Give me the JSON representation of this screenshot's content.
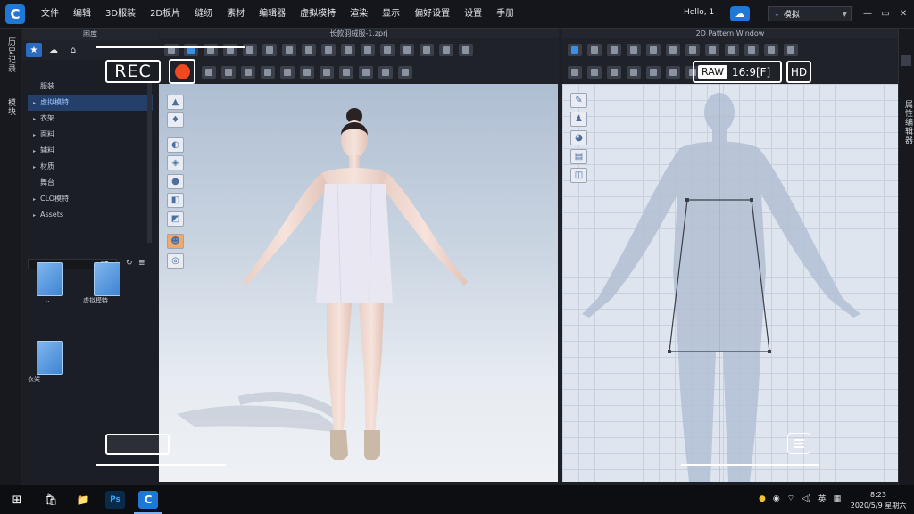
{
  "menubar": {
    "logo": "C",
    "items": [
      "文件",
      "编辑",
      "3D服装",
      "2D板片",
      "缝纫",
      "素材",
      "编辑器",
      "虚拟模特",
      "渲染",
      "显示",
      "偏好设置",
      "设置",
      "手册"
    ],
    "hello": "Hello, 1",
    "mode_label": "模拟"
  },
  "left_strip": {
    "tab1": "历史记录",
    "tab2": "模块"
  },
  "right_strip": {
    "tab1": "属性编辑器"
  },
  "library": {
    "title": "图库",
    "tree": [
      {
        "label": "服装",
        "arrow": ""
      },
      {
        "label": "虚拟模特",
        "arrow": "▸"
      },
      {
        "label": "衣架",
        "arrow": "▸"
      },
      {
        "label": "面料",
        "arrow": "▸"
      },
      {
        "label": "辅料",
        "arrow": "▸"
      },
      {
        "label": "材质",
        "arrow": "▸"
      },
      {
        "label": "舞台",
        "arrow": ""
      },
      {
        "label": "CLO模特",
        "arrow": "▸"
      },
      {
        "label": "Assets",
        "arrow": "▸"
      }
    ],
    "folders": [
      "..",
      "虚拟模特",
      "衣架"
    ]
  },
  "view3d": {
    "title": "长款羽绒服-1.zprj"
  },
  "view2d": {
    "title": "2D Pattern Window"
  },
  "overlay": {
    "rec": "REC",
    "raw": "RAW",
    "ratio": "16:9[F]",
    "hd": "HD"
  },
  "taskbar": {
    "apps": [
      "⊞",
      "🛍",
      "📁",
      "Ps",
      "C"
    ],
    "tray_lang": "英",
    "time": "8:23",
    "date": "2020/5/9 星期六"
  },
  "colors": {
    "accent": "#1f78d6",
    "rec_red": "#f0491e"
  }
}
